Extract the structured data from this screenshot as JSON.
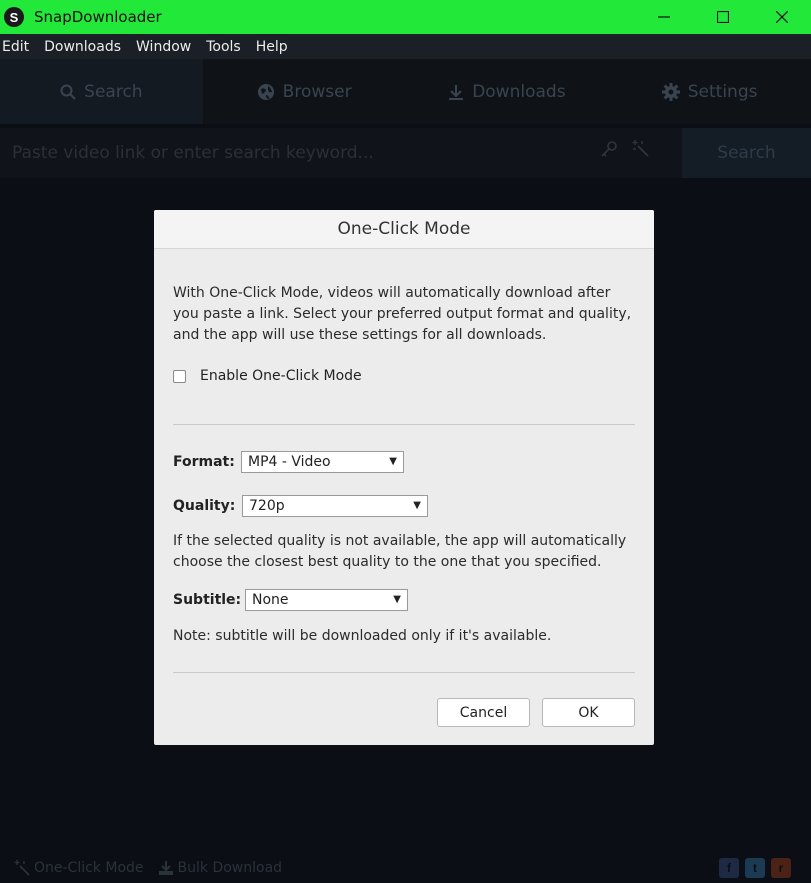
{
  "window": {
    "title": "SnapDownloader",
    "logo_letter": "S"
  },
  "menu": [
    "Edit",
    "Downloads",
    "Window",
    "Tools",
    "Help"
  ],
  "tabs": [
    {
      "label": "Search",
      "icon": "search-icon"
    },
    {
      "label": "Browser",
      "icon": "globe-icon"
    },
    {
      "label": "Downloads",
      "icon": "download-icon"
    },
    {
      "label": "Settings",
      "icon": "gear-icon"
    }
  ],
  "search": {
    "placeholder": "Paste video link or enter search keyword...",
    "button_label": "Search"
  },
  "dialog": {
    "title": "One-Click Mode",
    "description": "With One-Click Mode, videos will automatically download after you paste a link. Select your preferred output format and quality, and the app will use these settings for all downloads.",
    "enable_label": "Enable One-Click Mode",
    "enable_checked": false,
    "format_label": "Format:",
    "format_value": "MP4 - Video",
    "quality_label": "Quality:",
    "quality_value": "720p",
    "quality_note": "If the selected quality is not available, the app will automatically choose the closest best quality to the one that you specified.",
    "subtitle_label": "Subtitle:",
    "subtitle_value": "None",
    "subtitle_note": "Note: subtitle will be downloaded only if it's available.",
    "cancel_label": "Cancel",
    "ok_label": "OK"
  },
  "footer": {
    "one_click_label": "One-Click Mode",
    "bulk_label": "Bulk Download",
    "social": [
      "f",
      "t",
      "r"
    ]
  },
  "colors": {
    "titlebar": "#22e83a",
    "background": "#0b0e14",
    "dialog": "#ececec"
  }
}
